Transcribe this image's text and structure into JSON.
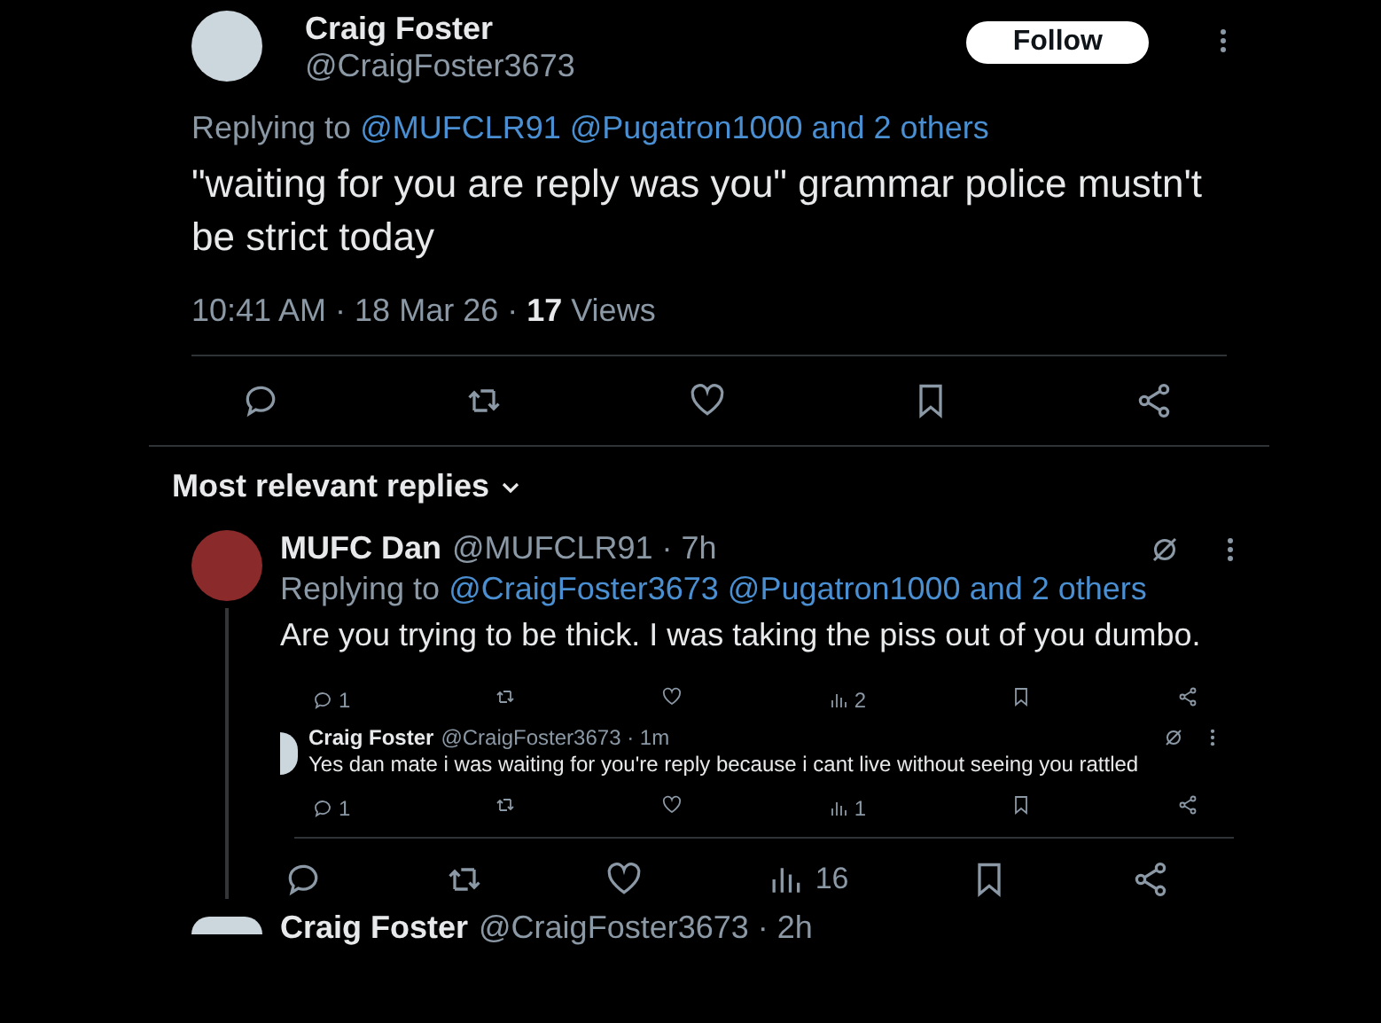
{
  "tweet": {
    "name": "Craig Foster",
    "handle": "@CraigFoster3673",
    "follow_button": "Follow",
    "replying_label": "Replying to",
    "replying_to": [
      "@MUFCLR91",
      "@Pugatron1000",
      "and 2 others"
    ],
    "text": "\"waiting for you are reply was you\" grammar police mustn't be strict today",
    "meta": "10:41 AM · 18 Mar 26 · **17** Views",
    "actions": [
      {
        "kind": "reply"
      },
      {
        "kind": "repost"
      },
      {
        "kind": "like"
      },
      {
        "kind": "bookmark"
      },
      {
        "kind": "share"
      }
    ]
  },
  "replies_sort": "Most relevant replies",
  "replies": [
    {
      "name": "MUFC Dan",
      "meta": "@MUFCLR91 · 7h",
      "replying_label": "Replying to",
      "replying_to": [
        "@CraigFoster3673",
        "@Pugatron1000",
        "and 2 others"
      ],
      "text": "Are you trying to be thick. I was taking the piss out of you dumbo.",
      "screenshot": {
        "actions": [
          {
            "kind": "reply",
            "count": "1"
          },
          {
            "kind": "repost"
          },
          {
            "kind": "like"
          },
          {
            "kind": "views",
            "count": "2"
          },
          {
            "kind": "bookmark"
          },
          {
            "kind": "share"
          }
        ],
        "reply": {
          "name": "Craig Foster",
          "meta": "@CraigFoster3673 · 1m",
          "text": "Yes dan mate i was waiting for you're reply because i cant live without seeing you rattled",
          "actions": [
            {
              "kind": "reply",
              "count": "1"
            },
            {
              "kind": "repost"
            },
            {
              "kind": "like"
            },
            {
              "kind": "views",
              "count": "1"
            },
            {
              "kind": "bookmark"
            },
            {
              "kind": "share"
            }
          ]
        }
      },
      "actions": [
        {
          "kind": "reply"
        },
        {
          "kind": "repost"
        },
        {
          "kind": "like"
        },
        {
          "kind": "views",
          "count": "16"
        },
        {
          "kind": "bookmark"
        },
        {
          "kind": "share"
        }
      ]
    },
    {
      "name": "Craig Foster",
      "meta": "@CraigFoster3673 · 2h"
    }
  ]
}
